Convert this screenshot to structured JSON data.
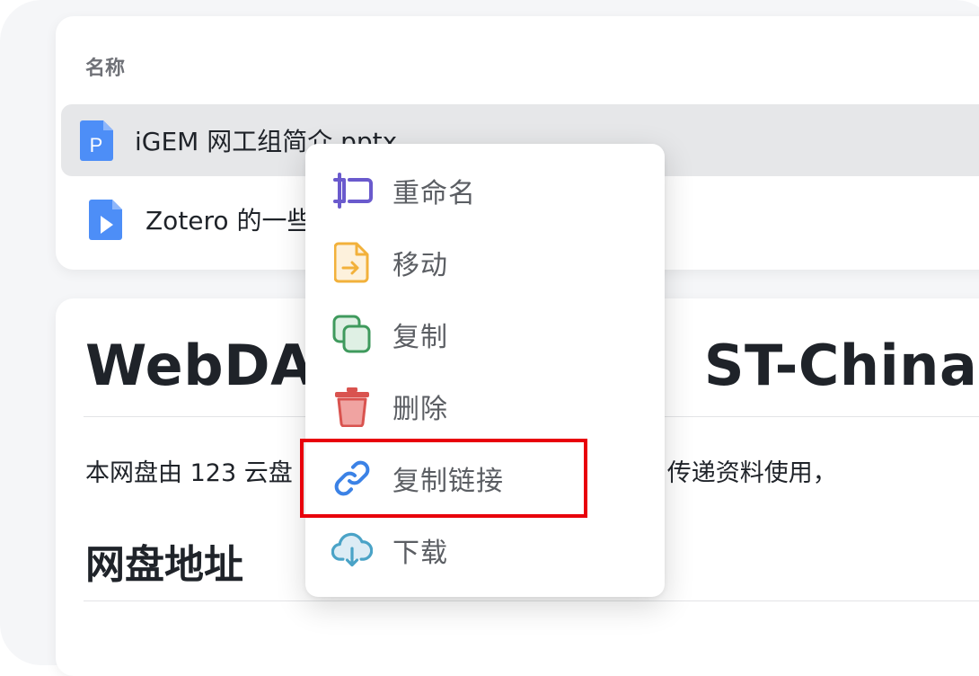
{
  "file_list": {
    "column_header": "名称",
    "files": [
      {
        "name": "iGEM 网工组简介.pptx",
        "icon": "pptx-file-icon",
        "color": "#4d8ef7"
      },
      {
        "name": "Zotero 的一些",
        "icon": "video-file-icon",
        "color": "#4d8ef7"
      }
    ]
  },
  "readme": {
    "title_left": "WebDAV",
    "title_right": "ST-China",
    "paragraph_left": "本网盘由 123 云盘",
    "paragraph_right": "内部存储、传递资料使用，",
    "heading": "网盘地址"
  },
  "context_menu": {
    "items": [
      {
        "label": "重命名",
        "icon": "rename-icon",
        "color": "#6a5acd"
      },
      {
        "label": "移动",
        "icon": "move-file-icon",
        "color": "#f2b13b"
      },
      {
        "label": "复制",
        "icon": "copy-icon",
        "color": "#3f9a5d"
      },
      {
        "label": "删除",
        "icon": "trash-icon",
        "color": "#d9534f"
      },
      {
        "label": "复制链接",
        "icon": "link-icon",
        "color": "#3b82e6"
      },
      {
        "label": "下载",
        "icon": "cloud-download-icon",
        "color": "#4aa3c7"
      }
    ]
  },
  "highlight_color": "#e8000b"
}
